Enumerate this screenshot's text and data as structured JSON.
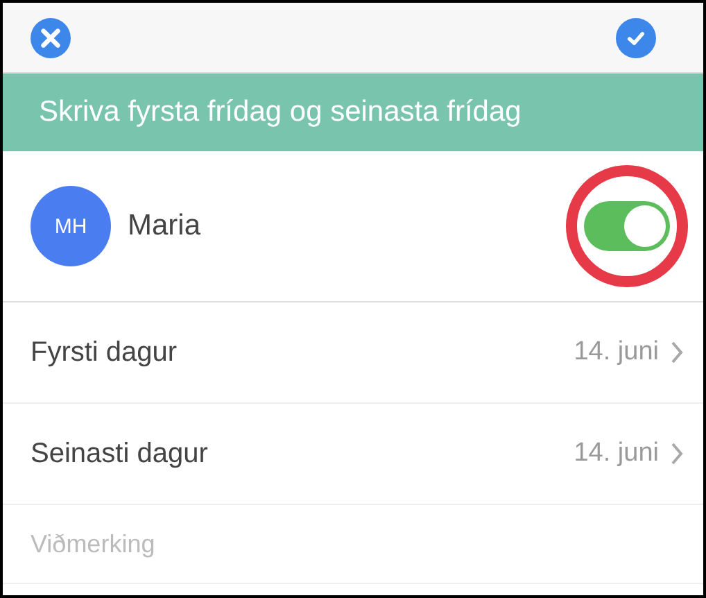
{
  "banner": {
    "title": "Skriva fyrsta frídag og seinasta frídag"
  },
  "person": {
    "initials": "MH",
    "name": "Maria",
    "on": true,
    "highlighted": true
  },
  "rows": [
    {
      "label": "Fyrsti dagur",
      "value": "14. juni"
    },
    {
      "label": "Seinasti dagur",
      "value": "14. juni"
    }
  ],
  "comment": {
    "placeholder": "Viðmerking"
  }
}
